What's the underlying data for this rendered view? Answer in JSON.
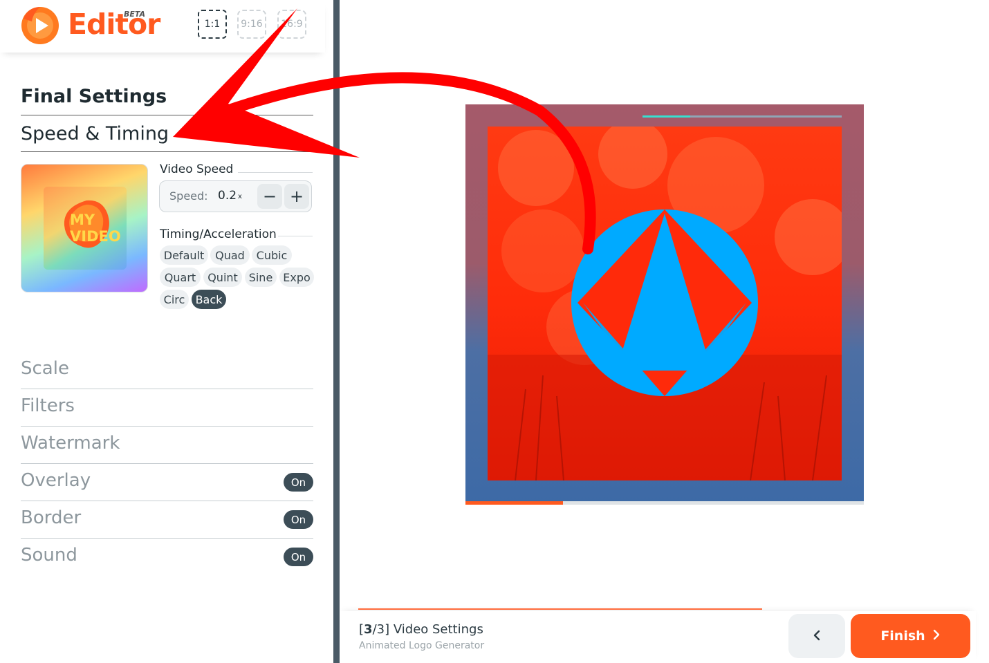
{
  "header": {
    "logo_text": "Editor",
    "beta_label": "BETA",
    "ratios": [
      {
        "label": "1:1",
        "active": true
      },
      {
        "label": "9:16",
        "active": false
      },
      {
        "label": "16:9",
        "active": false
      }
    ]
  },
  "settings": {
    "title": "Final Settings",
    "active_section": "Speed & Timing",
    "thumbnail_text": "MY VIDEO",
    "video_speed": {
      "heading": "Video Speed",
      "label": "Speed:",
      "value": "0.2",
      "unit": "x",
      "decrement_icon": "minus-icon",
      "increment_icon": "plus-icon"
    },
    "timing": {
      "heading": "Timing/Acceleration",
      "options": [
        "Default",
        "Quad",
        "Cubic",
        "Quart",
        "Quint",
        "Sine",
        "Expo",
        "Circ",
        "Back"
      ],
      "selected": "Back"
    },
    "sections": [
      {
        "label": "Scale",
        "toggle": null
      },
      {
        "label": "Filters",
        "toggle": null
      },
      {
        "label": "Watermark",
        "toggle": null
      },
      {
        "label": "Overlay",
        "toggle": "On"
      },
      {
        "label": "Border",
        "toggle": "On"
      },
      {
        "label": "Sound",
        "toggle": "On"
      }
    ]
  },
  "preview": {
    "top_progress": 0.24,
    "bottom_progress": 0.245,
    "accent_color": "#37e0d0",
    "progress_color": "#ff5a1f"
  },
  "footer": {
    "step_current": "3",
    "step_total": "3",
    "step_title": "Video Settings",
    "subtitle": "Animated Logo Generator",
    "back_icon": "chevron-left-icon",
    "finish_label": "Finish",
    "finish_icon": "chevron-right-icon",
    "brand_color": "#ff5a1f"
  }
}
